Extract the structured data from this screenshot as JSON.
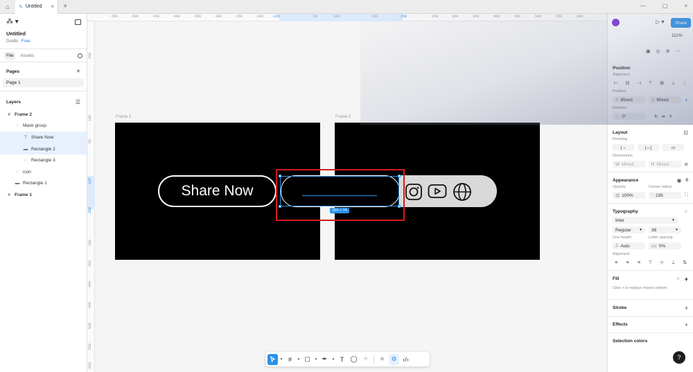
{
  "tabs": {
    "home_icon": "home-icon",
    "active_tab": "Untitled",
    "add": "+"
  },
  "left": {
    "file_title": "Untitled",
    "drafts": "Drafts",
    "plan": "Free",
    "tab_file": "File",
    "tab_assets": "Assets",
    "pages_label": "Pages",
    "page_1": "Page 1",
    "layers_label": "Layers",
    "layers": [
      {
        "name": "Frame 2",
        "icon": "#"
      },
      {
        "name": "Mask group",
        "icon": "◌"
      },
      {
        "name": "Share Now",
        "icon": "T"
      },
      {
        "name": "Rectangle 2",
        "icon": "▬"
      },
      {
        "name": "Rectangle 3",
        "icon": "◌"
      },
      {
        "name": "icon",
        "icon": "◌"
      },
      {
        "name": "Rectangle 1",
        "icon": "▬"
      },
      {
        "name": "Frame 1",
        "icon": "#"
      }
    ]
  },
  "canvas": {
    "ruler_top": [
      "-550",
      "-500",
      "-450",
      "-400",
      "-350",
      "-300",
      "-250",
      "-200",
      "-135",
      "50",
      "100",
      "150",
      "159",
      "250",
      "300",
      "350",
      "400",
      "450",
      "500",
      "550",
      "600"
    ],
    "ruler_left": [
      "200",
      "100",
      "50",
      "134",
      "208",
      "300",
      "350",
      "400",
      "450",
      "500",
      "550",
      "600"
    ],
    "frame_1_label": "Frame 1",
    "frame_2_label": "Frame 2",
    "button_text": "Share Now",
    "size_badge": "294 × 74"
  },
  "toolbar": {
    "move": "move-tool",
    "frame": "frame-tool",
    "shape": "rectangle-tool",
    "pen": "pen-tool",
    "text": "T",
    "comment": "comment-tool",
    "actions": "actions-tool"
  },
  "right": {
    "share": "Share",
    "zoom": "111%",
    "position_label": "Position",
    "alignment_label": "Alignment",
    "position_sub": "Position",
    "x_label": "X",
    "x_value": "Mixed",
    "y_label": "Y",
    "y_value": "Mixed",
    "rotation_label": "Rotation",
    "rotation_value": "0°",
    "layout_label": "Layout",
    "resizing_label": "Resizing",
    "dimensions_label": "Dimensions",
    "w_label": "W",
    "w_value": "Mixed",
    "h_label": "H",
    "h_value": "Mixed",
    "appearance_label": "Appearance",
    "opacity_label": "Opacity",
    "opacity_value": "100%",
    "radius_label": "Corner radius",
    "radius_value": "235",
    "typography_label": "Typography",
    "font_family": "Inter",
    "font_weight": "Regular",
    "font_size": "36",
    "line_height_label": "Line height",
    "line_height_value": "Auto",
    "letter_spacing_label": "Letter spacing",
    "letter_spacing_value": "0%",
    "text_alignment_label": "Alignment",
    "fill_label": "Fill",
    "fill_hint": "Click + to replace mixed content",
    "stroke_label": "Stroke",
    "effects_label": "Effects",
    "selection_colors_label": "Selection colors",
    "help": "?"
  },
  "colors": {
    "accent": "#2b90e8",
    "highlight": "#d41b1b",
    "frame": "#000000",
    "pill_gray": "#d9d9d9"
  }
}
